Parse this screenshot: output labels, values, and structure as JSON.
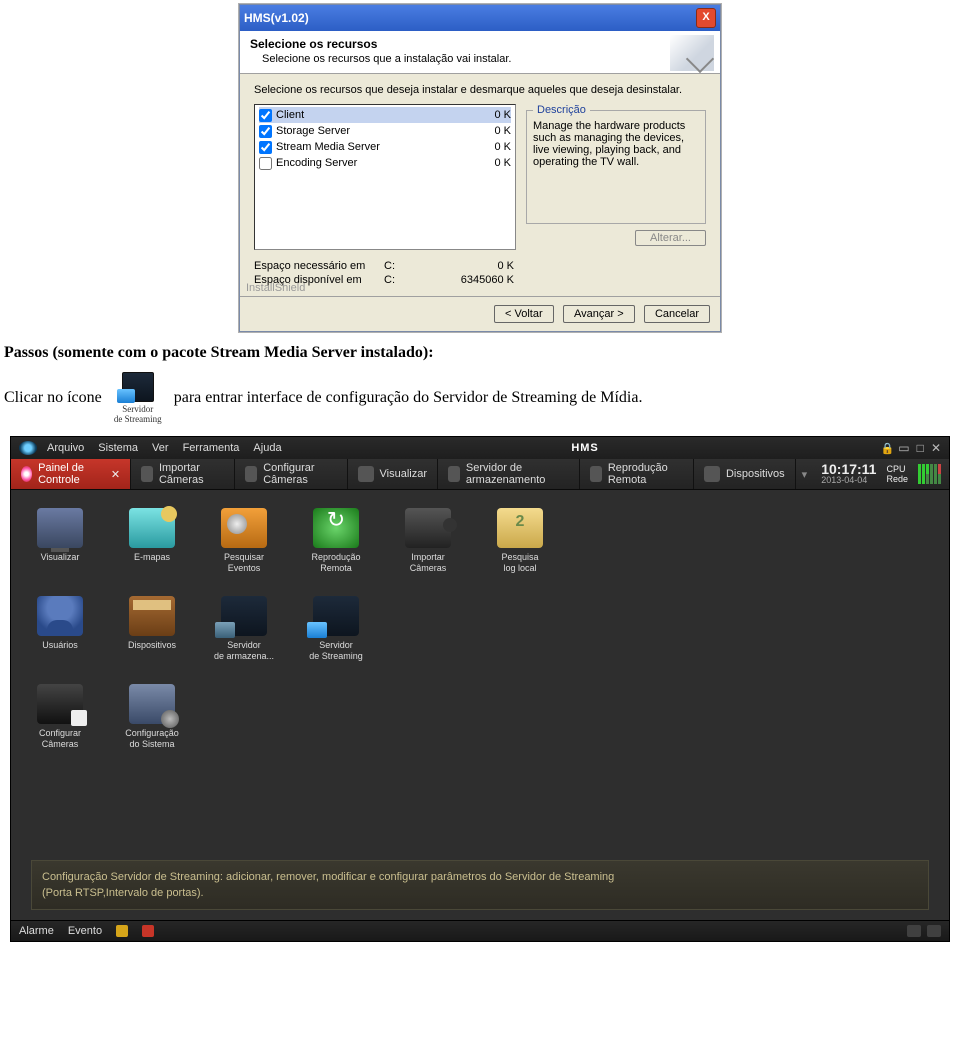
{
  "installer": {
    "title": "HMS(v1.02)",
    "heading": "Selecione os recursos",
    "subheading": "Selecione os recursos que a instalação vai instalar.",
    "intro": "Selecione os recursos que deseja instalar e desmarque aqueles que deseja desinstalar.",
    "components": [
      {
        "name": "Client",
        "size": "0 K",
        "checked": true,
        "selected": true
      },
      {
        "name": "Storage Server",
        "size": "0 K",
        "checked": true
      },
      {
        "name": "Stream Media Server",
        "size": "0 K",
        "checked": true
      },
      {
        "name": "Encoding Server",
        "size": "0 K",
        "checked": false
      }
    ],
    "description_legend": "Descrição",
    "description_text": "Manage the hardware products such as managing the devices, live viewing, playing back, and operating the TV wall.",
    "alterar": "Alterar...",
    "space_needed_label": "Espaço necessário em",
    "space_free_label": "Espaço disponível em",
    "space_drive": "C:",
    "space_needed_value": "0 K",
    "space_free_value": "6345060 K",
    "installshield": "InstallShield",
    "btn_back": "< Voltar",
    "btn_next": "Avançar >",
    "btn_cancel": "Cancelar"
  },
  "doc": {
    "passos": "Passos (somente com o pacote Stream Media Server instalado):",
    "line_pre": "Clicar no ícone",
    "line_post": "para entrar interface de configuração do Servidor de Streaming de Mídia.",
    "icon_label": "Servidor\nde Streaming"
  },
  "hms": {
    "menu": [
      "Arquivo",
      "Sistema",
      "Ver",
      "Ferramenta",
      "Ajuda"
    ],
    "title": "HMS",
    "tabs": [
      {
        "label": "Painel de Controle",
        "active": true
      },
      {
        "label": "Importar Câmeras"
      },
      {
        "label": "Configurar Câmeras"
      },
      {
        "label": "Visualizar"
      },
      {
        "label": "Servidor de armazenamento"
      },
      {
        "label": "Reprodução Remota"
      },
      {
        "label": "Dispositivos"
      }
    ],
    "clock_time": "10:17:11",
    "clock_date": "2013-04-04",
    "cpu": "CPU",
    "rede": "Rede",
    "icons": [
      {
        "label": "Visualizar",
        "cls": "ic-monitor"
      },
      {
        "label": "E-mapas",
        "cls": "ic-emap"
      },
      {
        "label": "Pesquisar\nEventos",
        "cls": "ic-folder"
      },
      {
        "label": "Reprodução\nRemota",
        "cls": "ic-reload"
      },
      {
        "label": "Importar\nCâmeras",
        "cls": "ic-cam"
      },
      {
        "label": "Pesquisa\nlog local",
        "cls": "ic-clipboard"
      },
      {
        "label": "Usuários",
        "cls": "ic-user"
      },
      {
        "label": "Dispositivos",
        "cls": "ic-drawer"
      },
      {
        "label": "Servidor\nde armazena...",
        "cls": "ic-server"
      },
      {
        "label": "Servidor\nde Streaming",
        "cls": "ic-stream"
      },
      {
        "label": "Configurar\nCâmeras",
        "cls": "ic-confcam"
      },
      {
        "label": "Configuração\ndo Sistema",
        "cls": "ic-confsys"
      }
    ],
    "icons_per_row": [
      6,
      4,
      2
    ],
    "hint_line1": "Configuração Servidor de Streaming: adicionar, remover, modificar e configurar parâmetros do Servidor de Streaming",
    "hint_line2": "(Porta RTSP,Intervalo de portas).",
    "status_alarm": "Alarme",
    "status_event": "Evento"
  }
}
